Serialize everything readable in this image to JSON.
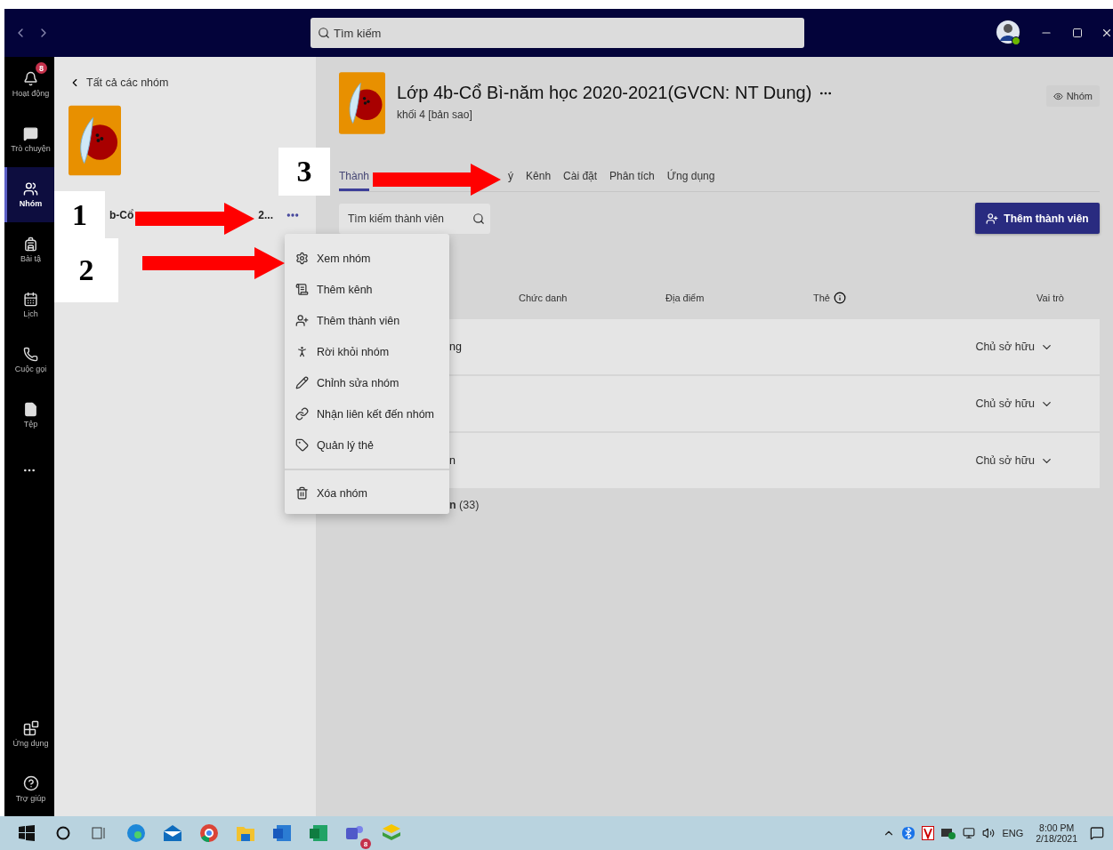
{
  "titlebar": {
    "search": {
      "placeholder": "Tìm kiếm"
    }
  },
  "rail": {
    "items": [
      {
        "label": "Hoạt động",
        "badge": "8",
        "selected": false
      },
      {
        "label": "Trò chuyện",
        "selected": false
      },
      {
        "label": "Nhóm",
        "selected": true
      },
      {
        "label": "Bài tậ",
        "selected": false
      },
      {
        "label": "Lịch",
        "selected": false
      },
      {
        "label": "Cuộc gọi",
        "selected": false
      },
      {
        "label": "Tệp",
        "selected": false
      }
    ],
    "bottom_items": [
      {
        "label": "Ứng dụng"
      },
      {
        "label": "Trợ giúp"
      }
    ]
  },
  "team_panel": {
    "back_link": "Tất cả các nhóm",
    "team_name_parts": [
      "b-Cổ",
      "2..."
    ]
  },
  "menu": {
    "sections": [
      [
        "Xem nhóm",
        "Thêm kênh",
        "Thêm thành viên",
        "Rời khỏi nhóm",
        "Chỉnh sửa nhóm",
        "Nhận liên kết đến nhóm",
        "Quản lý thẻ"
      ],
      [
        "Xóa nhóm"
      ]
    ]
  },
  "header": {
    "title": "Lớp 4b-Cổ Bì-năm học 2020-2021(GVCN: NT Dung)",
    "subtitle": "khối 4 [bản sao]",
    "privacy": "Nhóm"
  },
  "tabs": [
    {
      "label": "Thành",
      "selected": true
    },
    {
      "label": "ý",
      "selected": false
    },
    {
      "label": "Kênh",
      "selected": false
    },
    {
      "label": "Cài đặt",
      "selected": false
    },
    {
      "label": "Phân tích",
      "selected": false
    },
    {
      "label": "Ứng dụng",
      "selected": false
    }
  ],
  "member_search": {
    "placeholder": "Tìm kiếm thành viên"
  },
  "add_button": "Thêm thành viên",
  "columns": [
    "Chức danh",
    "Địa điểm",
    "Thẻ",
    "Vai trò"
  ],
  "rows": [
    {
      "name": "ng",
      "role": "Chủ sở hữu"
    },
    {
      "role": "Chủ sở hữu"
    },
    {
      "name": "n",
      "role": "Chủ sở hữu"
    }
  ],
  "guests_section": "**n** (33)",
  "annotations": [
    "1",
    "2",
    "3"
  ],
  "taskbar": {
    "teams_badge": "8",
    "language": "ENG",
    "time": "8:00 PM",
    "date": "2/18/2021"
  }
}
